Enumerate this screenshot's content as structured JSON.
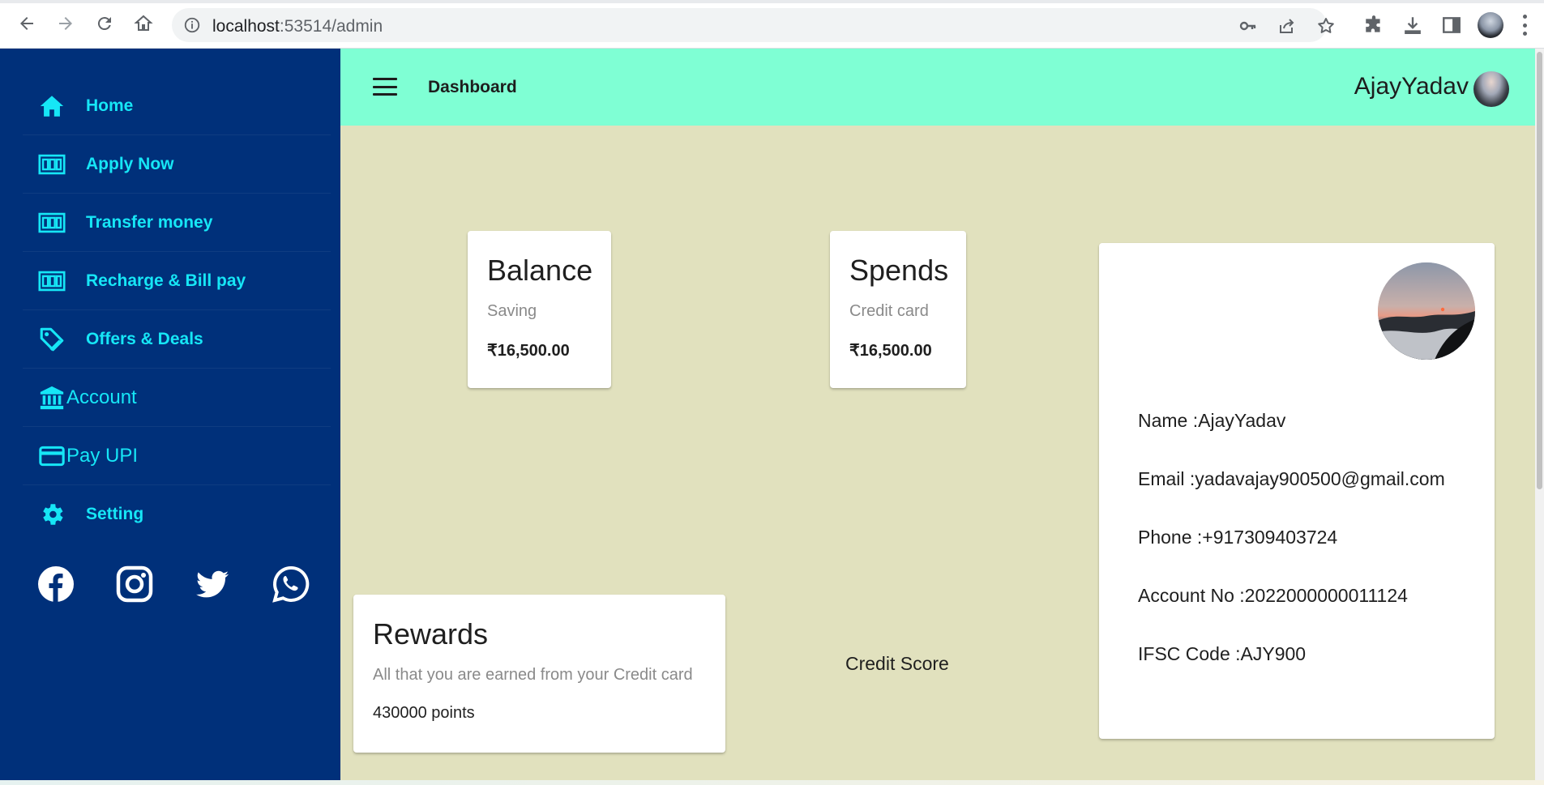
{
  "browser": {
    "url_host": "localhost",
    "url_rest": ":53514/admin"
  },
  "sidebar": {
    "items": [
      {
        "label": "Home",
        "icon": "home-icon"
      },
      {
        "label": "Apply Now",
        "icon": "grid-icon"
      },
      {
        "label": "Transfer money",
        "icon": "grid-icon"
      },
      {
        "label": "Recharge & Bill pay",
        "icon": "grid-icon"
      },
      {
        "label": "Offers & Deals",
        "icon": "tag-icon"
      },
      {
        "label": "Account",
        "icon": "bank-icon"
      },
      {
        "label": "Pay UPI",
        "icon": "credit-card-icon"
      },
      {
        "label": "Setting",
        "icon": "gear-icon"
      }
    ],
    "socials": [
      "facebook-icon",
      "instagram-icon",
      "twitter-icon",
      "whatsapp-icon"
    ]
  },
  "topbar": {
    "title": "Dashboard",
    "user_name": "AjayYadav"
  },
  "cards": {
    "balance": {
      "title": "Balance",
      "subtitle": "Saving",
      "value": "₹16,500.00"
    },
    "spends": {
      "title": "Spends",
      "subtitle": "Credit card",
      "value": "₹16,500.00"
    },
    "rewards": {
      "title": "Rewards",
      "subtitle": "All that you are earned from your Credit card",
      "value": "430000 points"
    }
  },
  "credit_score_label": "Credit Score",
  "profile": {
    "name": "Name :AjayYadav",
    "email": "Email :yadavajay900500@gmail.com",
    "phone": "Phone :+917309403724",
    "account": "Account No :2022000000011124",
    "ifsc": "IFSC Code :AJY900"
  },
  "colors": {
    "sidebar_bg": "#00307a",
    "sidebar_text": "#16e6f6",
    "topbar_bg": "#7fffd4",
    "content_bg": "#e1e1be"
  }
}
